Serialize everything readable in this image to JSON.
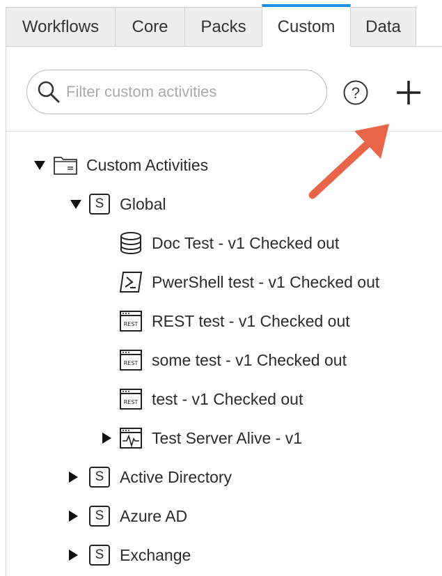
{
  "tabs": [
    {
      "label": "Workflows",
      "active": false
    },
    {
      "label": "Core",
      "active": false
    },
    {
      "label": "Packs",
      "active": false
    },
    {
      "label": "Custom",
      "active": true
    },
    {
      "label": "Data",
      "active": false
    }
  ],
  "search": {
    "placeholder": "Filter custom activities"
  },
  "tree": {
    "root": {
      "label": "Custom Activities",
      "expanded": true,
      "icon": "folder-icon"
    },
    "groups": [
      {
        "label": "Global",
        "badge": "S",
        "expanded": true,
        "items": [
          {
            "label": "Doc Test - v1 Checked out",
            "icon": "database-icon"
          },
          {
            "label": "PwerShell test - v1 Checked out",
            "icon": "powershell-icon"
          },
          {
            "label": "REST test - v1 Checked out",
            "icon": "rest-icon"
          },
          {
            "label": "some test - v1 Checked out",
            "icon": "rest-icon"
          },
          {
            "label": "test - v1 Checked out",
            "icon": "rest-icon"
          },
          {
            "label": "Test Server Alive - v1",
            "icon": "server-pulse-icon",
            "expandable": true
          }
        ]
      },
      {
        "label": "Active Directory",
        "badge": "S",
        "expanded": false
      },
      {
        "label": "Azure AD",
        "badge": "S",
        "expanded": false
      },
      {
        "label": "Exchange",
        "badge": "S",
        "expanded": false
      }
    ]
  },
  "rest_icon_text": "REST",
  "colors": {
    "accent": "#1a8fe8",
    "arrow": "#e8654a"
  }
}
